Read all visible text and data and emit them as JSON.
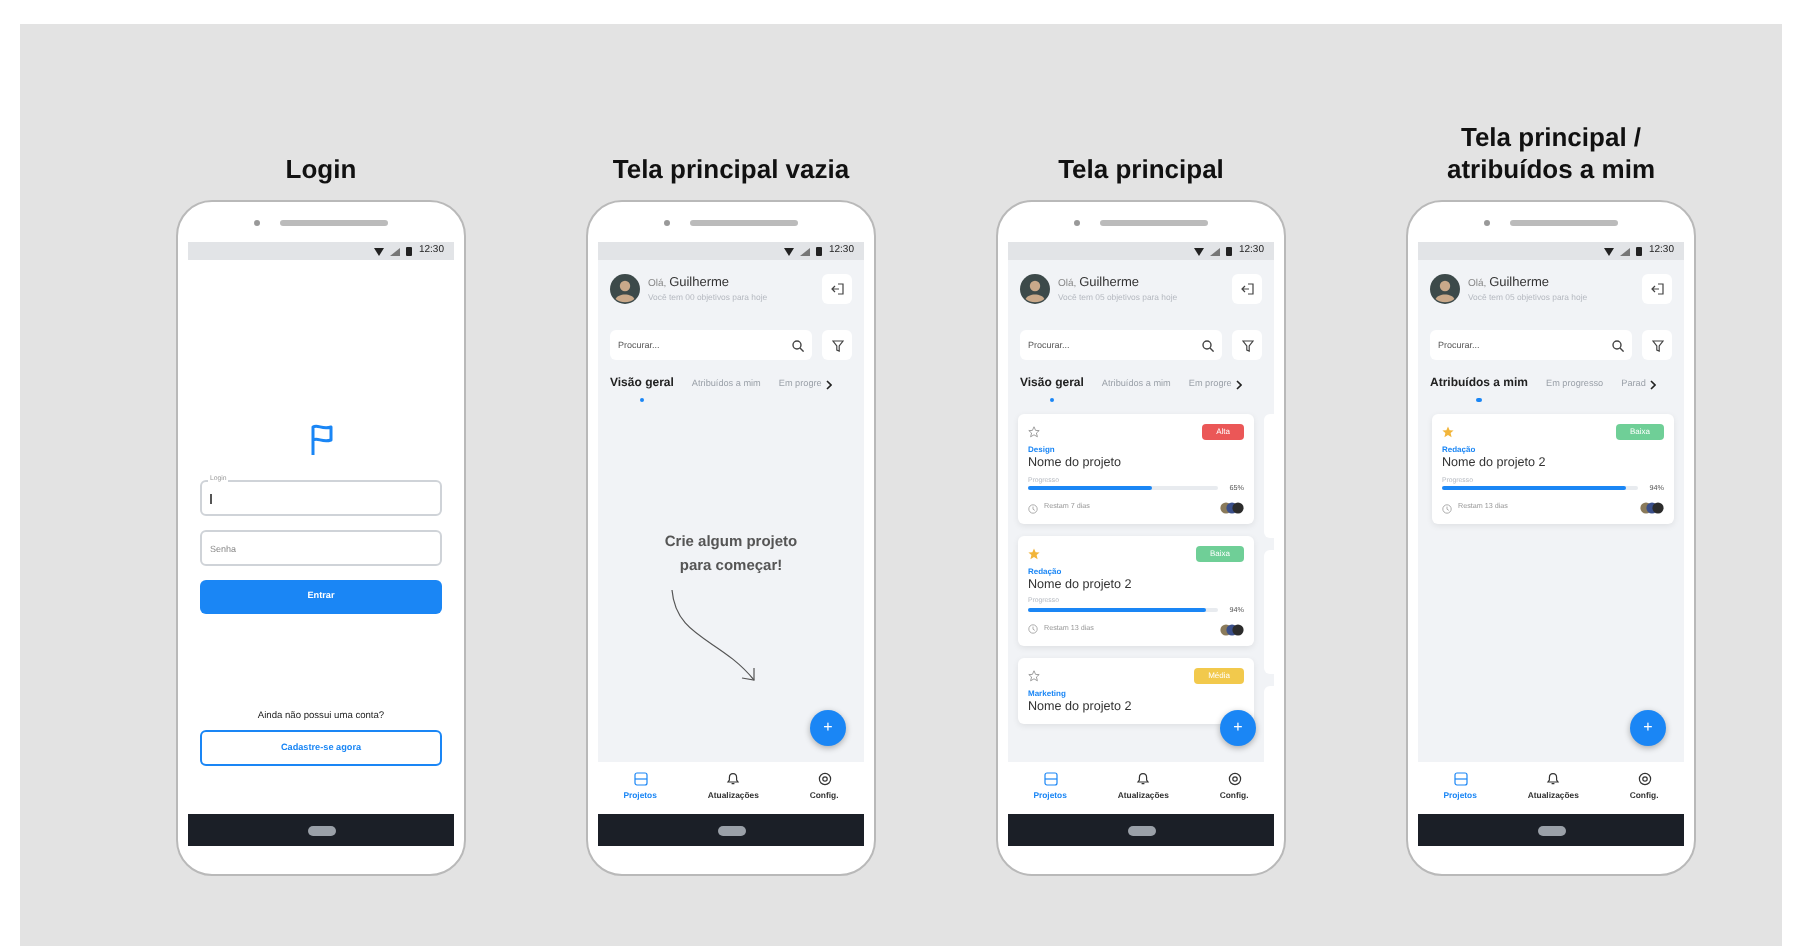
{
  "screens": [
    {
      "kind": "login",
      "title": "Login",
      "status_time": "12:30",
      "login_field": {
        "label": "Login"
      },
      "password_field": {
        "placeholder": "Senha"
      },
      "submit_button": "Entrar",
      "signup_prompt": "Ainda não possui uma conta?",
      "signup_button": "Cadastre-se agora"
    },
    {
      "kind": "home",
      "title": "Tela principal vazia",
      "status_time": "12:30",
      "greeting": "Olá, **Guilherme**",
      "subtitle": "Você tem 00 objetivos para hoje",
      "search": {
        "placeholder": "Procurar..."
      },
      "tabs": [
        {
          "label": "Visão geral",
          "selected": true
        },
        {
          "label": "Atribuídos a mim",
          "selected": false
        },
        {
          "label": "Em progre",
          "selected": false
        }
      ],
      "empty_message": "Crie algum projeto para começar!",
      "fab": "+",
      "nav": [
        {
          "label": "Projetos",
          "selected": true
        },
        {
          "label": "Atualizações",
          "selected": false
        },
        {
          "label": "Config.",
          "selected": false
        }
      ]
    },
    {
      "kind": "home",
      "title": "Tela principal",
      "status_time": "12:30",
      "greeting": "Olá, **Guilherme**",
      "subtitle": "Você tem 05 objetivos para hoje",
      "search": {
        "placeholder": "Procurar..."
      },
      "tabs": [
        {
          "label": "Visão geral",
          "selected": true
        },
        {
          "label": "Atribuídos a mim",
          "selected": false
        },
        {
          "label": "Em progre",
          "selected": false
        }
      ],
      "more_cards_right": true,
      "projects": [
        {
          "starred": false,
          "priority": "Alta",
          "color": "#eb5757",
          "category": "Design",
          "name": "Nome do projeto",
          "progress_label": "Progresso",
          "level": 0.65,
          "percent": "65%",
          "time": "Restam 7 dias"
        },
        {
          "starred": true,
          "priority": "Baixa",
          "color": "#6fcf97",
          "category": "Redação",
          "name": "Nome do projeto 2",
          "progress_label": "Progresso",
          "level": 0.94,
          "percent": "94%",
          "time": "Restam 13 dias"
        },
        {
          "starred": false,
          "priority": "Média",
          "color": "#f2c94c",
          "category": "Marketing",
          "name": "Nome do projeto 2"
        }
      ],
      "fab": "+",
      "nav": [
        {
          "label": "Projetos",
          "selected": true
        },
        {
          "label": "Atualizações",
          "selected": false
        },
        {
          "label": "Config.",
          "selected": false
        }
      ]
    },
    {
      "kind": "home",
      "title": "Tela principal /\natribuídos a mim",
      "status_time": "12:30",
      "greeting": "Olá, **Guilherme**",
      "subtitle": "Você tem 05 objetivos para hoje",
      "search": {
        "placeholder": "Procurar..."
      },
      "tabs": [
        {
          "label": "Atribuídos a mim",
          "selected": true
        },
        {
          "label": "Em progresso",
          "selected": false
        },
        {
          "label": "Parad",
          "selected": false
        }
      ],
      "projects": [
        {
          "starred": true,
          "priority": "Baixa",
          "color": "#6fcf97",
          "category": "Redação",
          "name": "Nome do projeto 2",
          "progress_label": "Progresso",
          "level": 0.94,
          "percent": "94%",
          "time": "Restam 13 dias"
        }
      ],
      "fab": "+",
      "nav": [
        {
          "label": "Projetos",
          "selected": true
        },
        {
          "label": "Atualizações",
          "selected": false
        },
        {
          "label": "Config.",
          "selected": false
        }
      ]
    }
  ]
}
